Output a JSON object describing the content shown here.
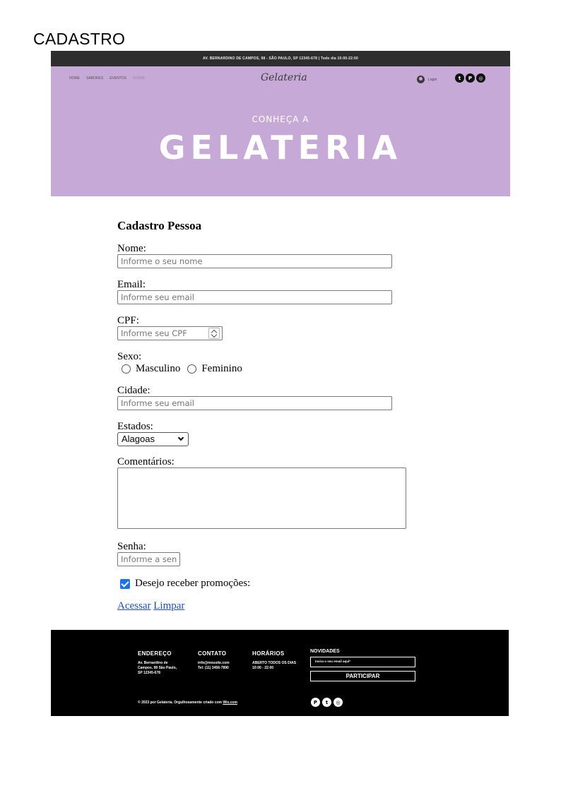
{
  "page_title": "CADASTRO",
  "banner": {
    "topbar_text": "AV. BERNARDINO DE CAMPOS, 98 - SÃO PAULO, SP 12345-678  |  Todo dia 10:00-22:00",
    "nav": [
      "HOME",
      "SABORES",
      "EVENTOS",
      "SOBRE"
    ],
    "logo": "Gelateria",
    "login_label": "Login",
    "social": [
      "twitter-icon",
      "pinterest-icon",
      "instagram-icon"
    ],
    "hero_subtitle": "CONHEÇA A",
    "hero_title": "GELATERIA"
  },
  "form": {
    "heading": "Cadastro Pessoa",
    "nome": {
      "label": "Nome:",
      "placeholder": "Informe o seu nome"
    },
    "email": {
      "label": "Email:",
      "placeholder": "Informe seu email"
    },
    "cpf": {
      "label": "CPF:",
      "placeholder": "Informe seu CPF"
    },
    "sexo": {
      "label": "Sexo:",
      "options": [
        "Masculino",
        "Feminino"
      ]
    },
    "cidade": {
      "label": "Cidade:",
      "placeholder": "Informe seu email"
    },
    "estados": {
      "label": "Estados:",
      "selected": "Alagoas"
    },
    "comentarios": {
      "label": "Comentários:"
    },
    "senha": {
      "label": "Senha:",
      "placeholder": "Informe a sen"
    },
    "promo": {
      "label": "Desejo receber promoções:",
      "checked": true
    },
    "links": {
      "acessar": "Acessar",
      "limpar": "Limpar"
    }
  },
  "footer": {
    "endereco": {
      "title": "ENDEREÇO",
      "lines": [
        "Av. Bernardino de",
        "Campos, 98 São Paulo,",
        "SP 12345-678"
      ]
    },
    "contato": {
      "title": "CONTATO",
      "lines": [
        "info@meusite.com",
        "Tel: (11) 3456-7890"
      ]
    },
    "horarios": {
      "title": "HORÁRIOS",
      "lines": [
        "ABERTO TODOS OS DIAS",
        "10:00 - 22:00"
      ]
    },
    "novidades": {
      "title": "NOVIDADES",
      "input_placeholder": "Insira o seu email aqui*",
      "button": "PARTICIPAR"
    },
    "copyright_prefix": "© 2023 por Gelateria. Orgulhosamente criado com ",
    "copyright_link": "Wix.com",
    "social": [
      "pinterest-icon",
      "twitter-icon",
      "instagram-icon"
    ]
  }
}
